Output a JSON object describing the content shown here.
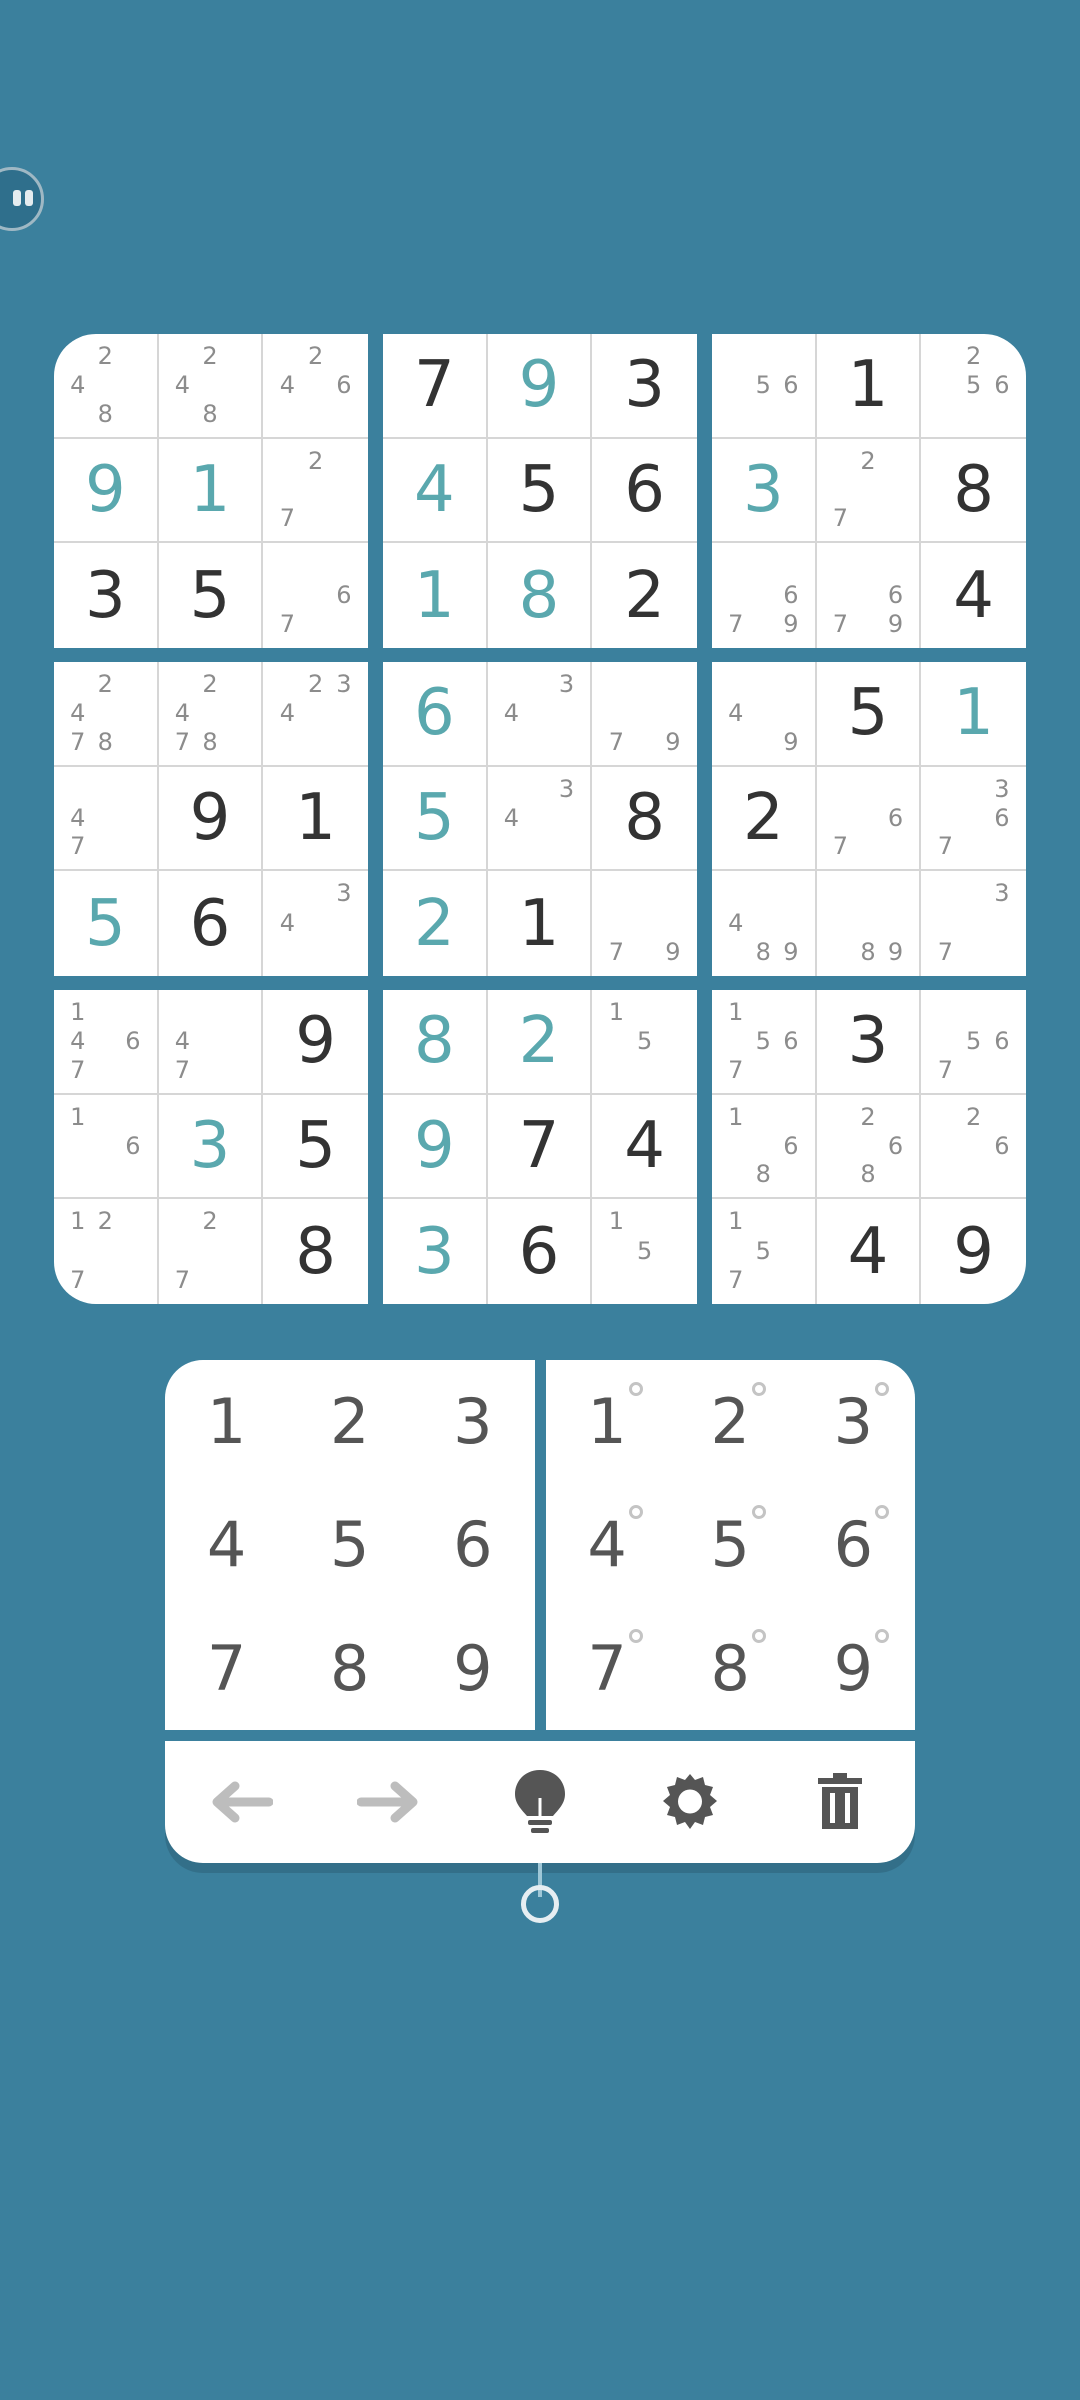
{
  "board": {
    "rows": [
      [
        {
          "n": [
            2,
            4,
            8
          ]
        },
        {
          "n": [
            2,
            4,
            8
          ]
        },
        {
          "n": [
            2,
            4,
            6
          ]
        },
        {
          "v": 7,
          "t": "given"
        },
        {
          "v": 9,
          "t": "user"
        },
        {
          "v": 3,
          "t": "given"
        },
        {
          "n": [
            5,
            6
          ]
        },
        {
          "v": 1,
          "t": "given"
        },
        {
          "n": [
            2,
            5,
            6
          ]
        }
      ],
      [
        {
          "v": 9,
          "t": "user"
        },
        {
          "v": 1,
          "t": "user"
        },
        {
          "n": [
            2,
            7
          ]
        },
        {
          "v": 4,
          "t": "user"
        },
        {
          "v": 5,
          "t": "given"
        },
        {
          "v": 6,
          "t": "given"
        },
        {
          "v": 3,
          "t": "user"
        },
        {
          "n": [
            2,
            7
          ]
        },
        {
          "v": 8,
          "t": "given"
        }
      ],
      [
        {
          "v": 3,
          "t": "given"
        },
        {
          "v": 5,
          "t": "given"
        },
        {
          "n": [
            6,
            7
          ]
        },
        {
          "v": 1,
          "t": "user"
        },
        {
          "v": 8,
          "t": "user"
        },
        {
          "v": 2,
          "t": "given"
        },
        {
          "n": [
            6,
            7,
            9
          ]
        },
        {
          "n": [
            6,
            7,
            9
          ]
        },
        {
          "v": 4,
          "t": "given"
        }
      ],
      [
        {
          "n": [
            2,
            4,
            7,
            8
          ]
        },
        {
          "n": [
            2,
            4,
            7,
            8
          ]
        },
        {
          "n": [
            2,
            3,
            4
          ]
        },
        {
          "v": 6,
          "t": "user"
        },
        {
          "n": [
            3,
            4
          ]
        },
        {
          "n": [
            7,
            9
          ]
        },
        {
          "n": [
            4,
            9
          ]
        },
        {
          "v": 5,
          "t": "given"
        },
        {
          "v": 1,
          "t": "user"
        }
      ],
      [
        {
          "n": [
            4,
            7
          ]
        },
        {
          "v": 9,
          "t": "given"
        },
        {
          "v": 1,
          "t": "given"
        },
        {
          "v": 5,
          "t": "user"
        },
        {
          "n": [
            3,
            4
          ]
        },
        {
          "v": 8,
          "t": "given"
        },
        {
          "v": 2,
          "t": "given"
        },
        {
          "n": [
            6,
            7
          ]
        },
        {
          "n": [
            3,
            6,
            7
          ]
        }
      ],
      [
        {
          "v": 5,
          "t": "user"
        },
        {
          "v": 6,
          "t": "given"
        },
        {
          "n": [
            3,
            4
          ]
        },
        {
          "v": 2,
          "t": "user"
        },
        {
          "v": 1,
          "t": "given"
        },
        {
          "n": [
            7,
            9
          ]
        },
        {
          "n": [
            4,
            8,
            9
          ]
        },
        {
          "n": [
            8,
            9
          ]
        },
        {
          "n": [
            3,
            7
          ]
        }
      ],
      [
        {
          "n": [
            1,
            4,
            6,
            7
          ]
        },
        {
          "n": [
            4,
            7
          ]
        },
        {
          "v": 9,
          "t": "given"
        },
        {
          "v": 8,
          "t": "user"
        },
        {
          "v": 2,
          "t": "user"
        },
        {
          "n": [
            1,
            5
          ]
        },
        {
          "n": [
            1,
            5,
            6,
            7
          ]
        },
        {
          "v": 3,
          "t": "given"
        },
        {
          "n": [
            5,
            6,
            7
          ]
        }
      ],
      [
        {
          "n": [
            1,
            6
          ]
        },
        {
          "v": 3,
          "t": "user"
        },
        {
          "v": 5,
          "t": "given"
        },
        {
          "v": 9,
          "t": "user"
        },
        {
          "v": 7,
          "t": "given"
        },
        {
          "v": 4,
          "t": "given"
        },
        {
          "n": [
            1,
            6,
            8
          ]
        },
        {
          "n": [
            2,
            6,
            8
          ]
        },
        {
          "n": [
            2,
            6
          ]
        }
      ],
      [
        {
          "n": [
            1,
            2,
            7
          ]
        },
        {
          "n": [
            2,
            7
          ]
        },
        {
          "v": 8,
          "t": "given"
        },
        {
          "v": 3,
          "t": "user"
        },
        {
          "v": 6,
          "t": "given"
        },
        {
          "n": [
            1,
            5
          ]
        },
        {
          "n": [
            1,
            5,
            7
          ]
        },
        {
          "v": 4,
          "t": "given"
        },
        {
          "v": 9,
          "t": "given"
        }
      ]
    ]
  },
  "numpad": {
    "digits": [
      "1",
      "2",
      "3",
      "4",
      "5",
      "6",
      "7",
      "8",
      "9"
    ]
  },
  "toolbar": {
    "items": [
      {
        "name": "undo-button",
        "icon": "arrow-left-icon"
      },
      {
        "name": "redo-button",
        "icon": "arrow-right-icon"
      },
      {
        "name": "hint-button",
        "icon": "lightbulb-icon"
      },
      {
        "name": "settings-button",
        "icon": "gear-icon"
      },
      {
        "name": "erase-button",
        "icon": "trash-icon"
      }
    ]
  },
  "colors": {
    "background": "#3b809d",
    "given": "#333333",
    "user": "#5aa8ae",
    "note": "#8c8c8c",
    "icon": "#555555",
    "icon_disabled": "#bdbdbd"
  }
}
